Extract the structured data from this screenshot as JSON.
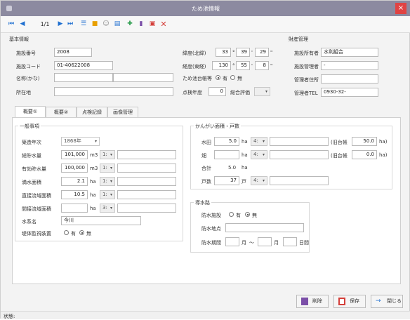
{
  "window": {
    "title": "ため池情報",
    "close": "×"
  },
  "toolbar": {
    "page": "1/1"
  },
  "colors": {
    "titlebar": "#8c8aa0",
    "nav_blue": "#1f6fd0",
    "close": "#e04343",
    "red_icon": "#d43f3a",
    "purple_icon": "#7b4fa8",
    "green_icon": "#2e9e4f"
  },
  "basic": {
    "section": "基本情報",
    "facility_no_label": "施設番号",
    "facility_no": "2008",
    "facility_code_label": "施設コード",
    "facility_code": "01-40622008",
    "name_label": "名称(かな)",
    "name": "",
    "name_kana": "",
    "location_label": "所在地",
    "location": "",
    "lat_label": "緯度(北緯)",
    "lat_d": "33",
    "lat_m": "39",
    "lat_s": "29",
    "lon_label": "経度(東経)",
    "lon_d": "130",
    "lon_m": "55",
    "lon_s": "8",
    "deg": "°",
    "min": "'",
    "sec": "\"",
    "tameike_label": "ため池台帳等",
    "yes": "有",
    "no": "無",
    "check_year_label": "点検年度",
    "check_year": "0",
    "eval_label": "総合評価"
  },
  "owner": {
    "section": "財産管理",
    "owner_label": "施設所有者",
    "owner": "水利組合",
    "manager_label": "施設管理者",
    "manager": "-",
    "addr_label": "管理者住所",
    "addr": "",
    "tel_label": "管理者TEL",
    "tel": "0930-32-"
  },
  "tabs": [
    "概要①",
    "概要②",
    "点検記録",
    "画像管理"
  ],
  "general": {
    "section": "一般事項",
    "year_label": "築造年次",
    "year": "1868年",
    "total_label": "総貯水量",
    "total": "101,000",
    "total_unit": "m3",
    "eff_label": "有効貯水量",
    "eff": "100,000",
    "eff_unit": "m3",
    "area_label": "満水面積",
    "area": "2.1",
    "area_unit": "ha",
    "direct_label": "直接流域面積",
    "direct": "10.5",
    "direct_unit": "ha",
    "indirect_label": "間接流域面積",
    "indirect": "",
    "indirect_unit": "ha",
    "water_label": "水系名",
    "water": "今川",
    "dam_label": "堤体監視装置",
    "sel1": "1:",
    "sel3": "3:"
  },
  "irrigation": {
    "section": "かんがい面積・戸数",
    "paddy_label": "水田",
    "paddy": "5.0",
    "paddy_unit": "ha",
    "paddy_sel": "4:",
    "field_label": "畑",
    "field": "",
    "field_unit": "ha",
    "field_sel": "4:",
    "sum_label": "合計",
    "sum": "5.0",
    "sum_unit": "ha",
    "households_label": "戸数",
    "households": "37",
    "households_unit": "戸",
    "households_sel": "4:",
    "old_label": "(旧台帳",
    "old1": "50.0",
    "old2": "0.0",
    "old_unit": "ha)"
  },
  "flood": {
    "section": "導水路",
    "fac_label": "防水施設",
    "yes": "有",
    "no": "無",
    "place_label": "防水地点",
    "period_label": "防水期間",
    "month": "月",
    "tilde": "～",
    "day": "日間"
  },
  "buttons": {
    "delete": "削除",
    "save": "保存",
    "close": "閉じる"
  },
  "status": "状態:"
}
